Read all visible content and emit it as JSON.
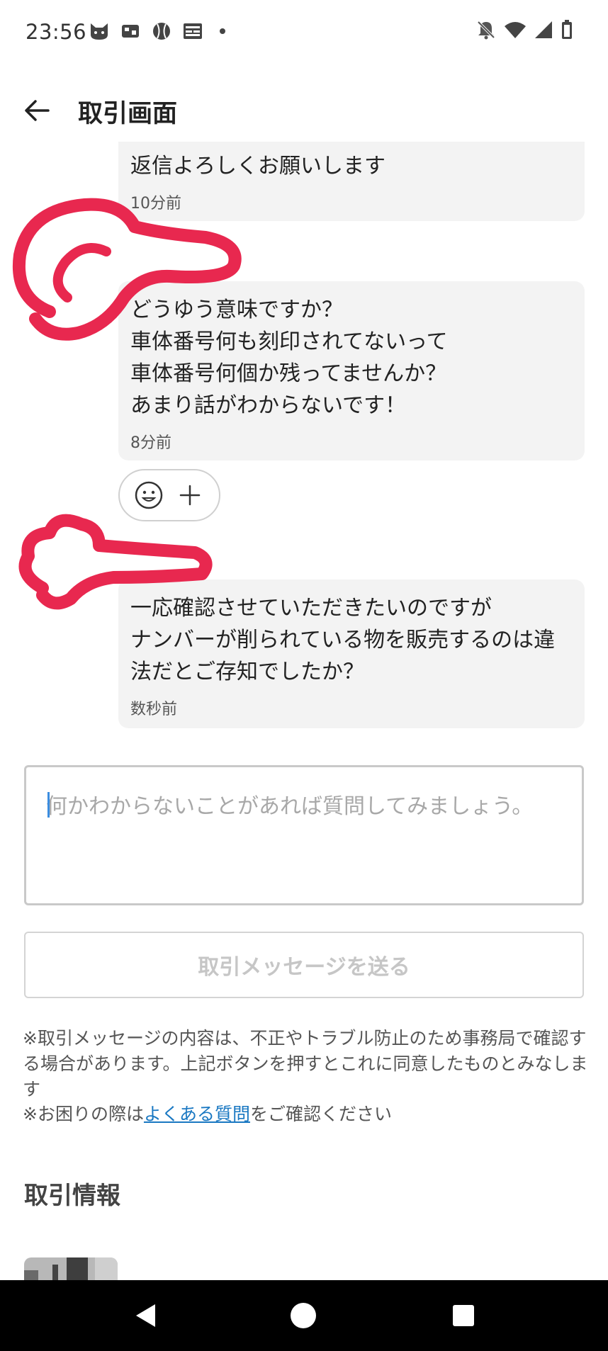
{
  "status_bar": {
    "time": "23:56",
    "notification_icons": [
      "cat-icon",
      "game-icon",
      "baseball-icon",
      "news-icon",
      "dot-icon"
    ],
    "system_icons": [
      "silent-bell-icon",
      "wifi-icon",
      "signal-icon",
      "battery-icon"
    ]
  },
  "app_bar": {
    "title": "取引画面",
    "back_icon": "back-arrow-icon"
  },
  "messages": [
    {
      "text": "返信よろしくお願いします",
      "time": "10分前"
    },
    {
      "text": "どうゆう意味ですか？\n車体番号何も刻印されてないって\n車体番号何個か残ってませんか？\nあまり話がわからないです！",
      "time": "8分前"
    },
    {
      "text": "一応確認させていただきたいのですが\nナンバーが削られている物を販売するのは違法だとご存知でしたか？",
      "time": "数秒前"
    }
  ],
  "reactions": {
    "emoji_icon": "smiley-icon",
    "add_icon": "plus-icon"
  },
  "composer": {
    "placeholder": "何かわからないことがあれば質問してみましょう。",
    "value": "",
    "send_label": "取引メッセージを送る"
  },
  "notice": {
    "text": "※取引メッセージの内容は、不正やトラブル防止のため事務局で確認する場合があります。上記ボタンを押すとこれに同意したものとみなします",
    "faq_prefix": "※お困りの際は",
    "faq_link": "よくある質問",
    "faq_suffix": "をご確認ください"
  },
  "section": {
    "title": "取引情報"
  },
  "colors": {
    "accent_link": "#1a78c2",
    "scribble": "#e8284f",
    "bubble_bg": "#f3f3f3"
  },
  "nav_bar": {
    "icons": [
      "nav-back-icon",
      "nav-home-icon",
      "nav-recents-icon"
    ]
  }
}
